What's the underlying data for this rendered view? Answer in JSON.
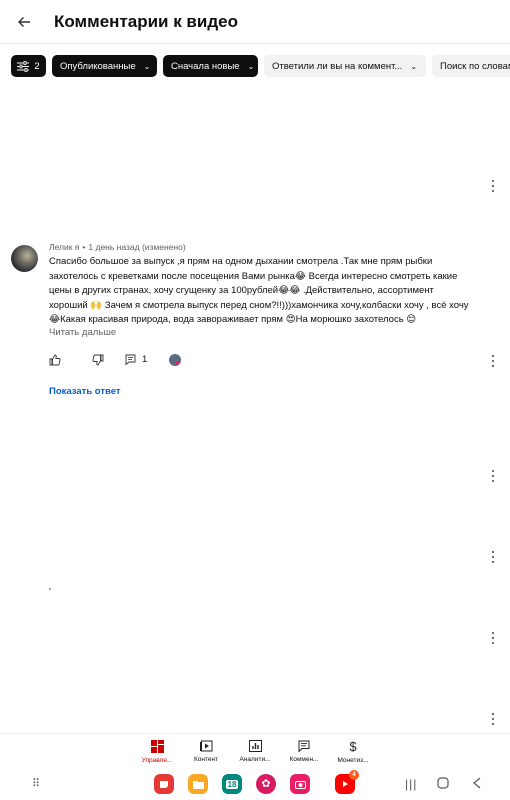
{
  "header": {
    "title": "Комментарии к видео",
    "back_icon": "arrow-left-icon"
  },
  "filters": {
    "count": "2",
    "chips": [
      {
        "label": "Опубликованные",
        "selected": true
      },
      {
        "label": "Сначала новые",
        "selected": true
      },
      {
        "label": "Ответили ли вы на коммент...",
        "selected": false
      },
      {
        "label": "Поиск по словам",
        "selected": false
      }
    ]
  },
  "comment": {
    "author": "Лелик я",
    "time": "1 день назад (изменено)",
    "text": "Спасибо большое за выпуск ,я прям на одном дыхании смотрела .Так мне прям рыбки захотелось с креветками после посещения Вами рынка😂 Всегда интересно смотреть какие цены в других странах, хочу сгущенку за 100рублей😂😂 .Действительно, ассортимент хороший 🙌 Зачем я смотрела выпуск перед сном?!!)))хамончика хочу,колбаски хочу , всё хочу 😂Какая красивая природа, вода завораживает прям 😍На морюшко захотелось 😌",
    "read_more": "Читать дальше",
    "reply_count": "1",
    "show_reply": "Показать ответ"
  },
  "bottom_nav": [
    {
      "label": "Управле...",
      "icon": "dashboard-icon",
      "active": true
    },
    {
      "label": "Контент",
      "icon": "video-content-icon",
      "active": false
    },
    {
      "label": "Аналити...",
      "icon": "analytics-icon",
      "active": false
    },
    {
      "label": "Коммен...",
      "icon": "comments-icon",
      "active": false
    },
    {
      "label": "Монетиз...",
      "icon": "monetization-icon",
      "active": false
    }
  ],
  "system_bar": {
    "calendar_day": "18",
    "youtube_badge": "4"
  },
  "colors": {
    "accent_red": "#cc0000",
    "link_blue": "#065fd4"
  }
}
